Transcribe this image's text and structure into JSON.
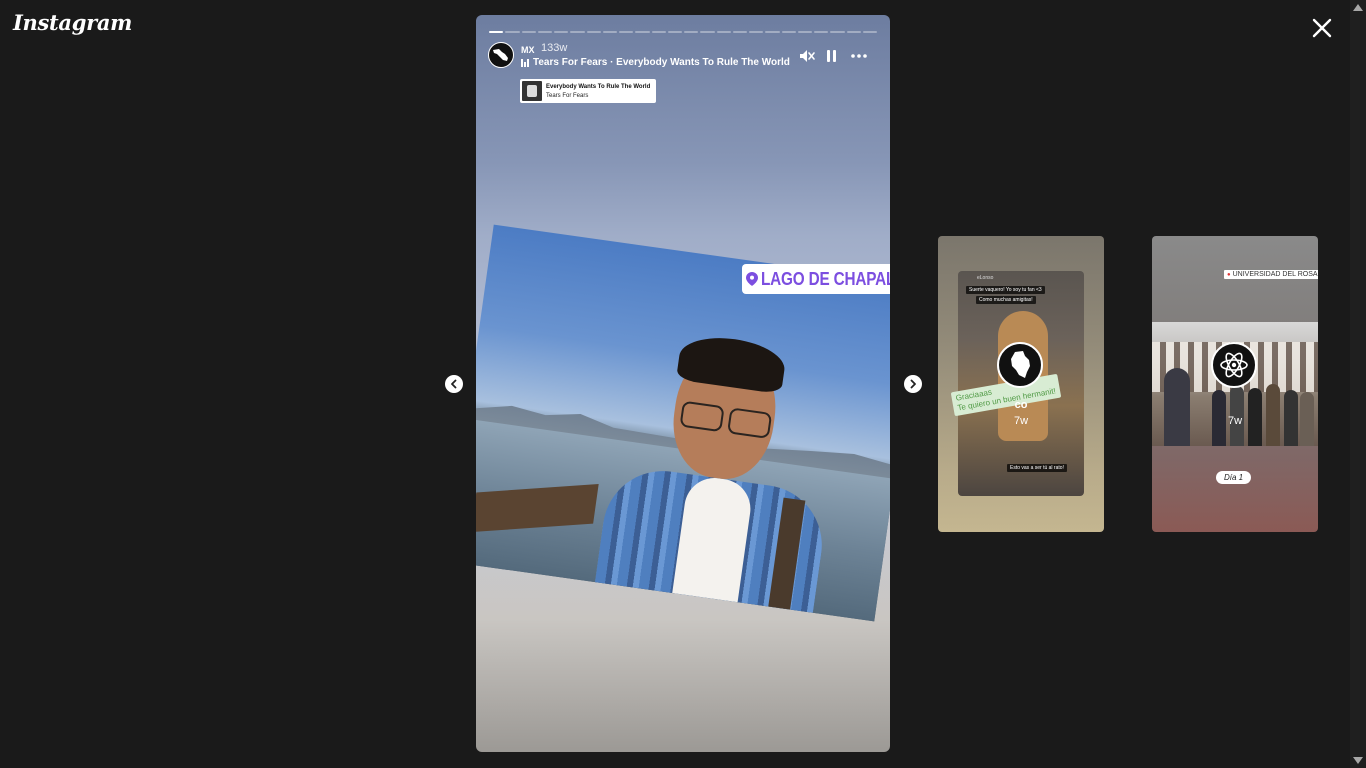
{
  "app": {
    "logo": "Instagram"
  },
  "story": {
    "username": "MX",
    "time": "133w",
    "music": "Tears For Fears · Everybody Wants To Rule The World",
    "sticker_title": "Everybody Wants To Rule The World",
    "sticker_artist": "Tears For Fears",
    "location": "LAGO DE CHAPALA",
    "progress_segments": 24,
    "active_segment": 1
  },
  "previews": [
    {
      "username": "co",
      "time": "7w",
      "overlay_top_1": "Suerte vaquero! Yo soy tu fan <3",
      "overlay_top_2": "Como muchas amigitas!",
      "green_text": "Graciaaas\nTe quiero un buen hermanit!",
      "overlay_bottom": "Esto vas a ser tú al rato!",
      "small_label": "eLonso"
    },
    {
      "username": "",
      "time": "7w",
      "location": "UNIVERSIDAD DEL ROSARIO",
      "caption": "Día 1"
    }
  ],
  "icons": {
    "close": "close-icon",
    "mute": "mute-icon",
    "pause": "pause-icon",
    "more": "more-icon",
    "prev": "chevron-left-icon",
    "next": "chevron-right-icon",
    "location": "location-pin-icon"
  },
  "colors": {
    "background": "#1a1a1a",
    "location_text": "#7c4ee0"
  }
}
